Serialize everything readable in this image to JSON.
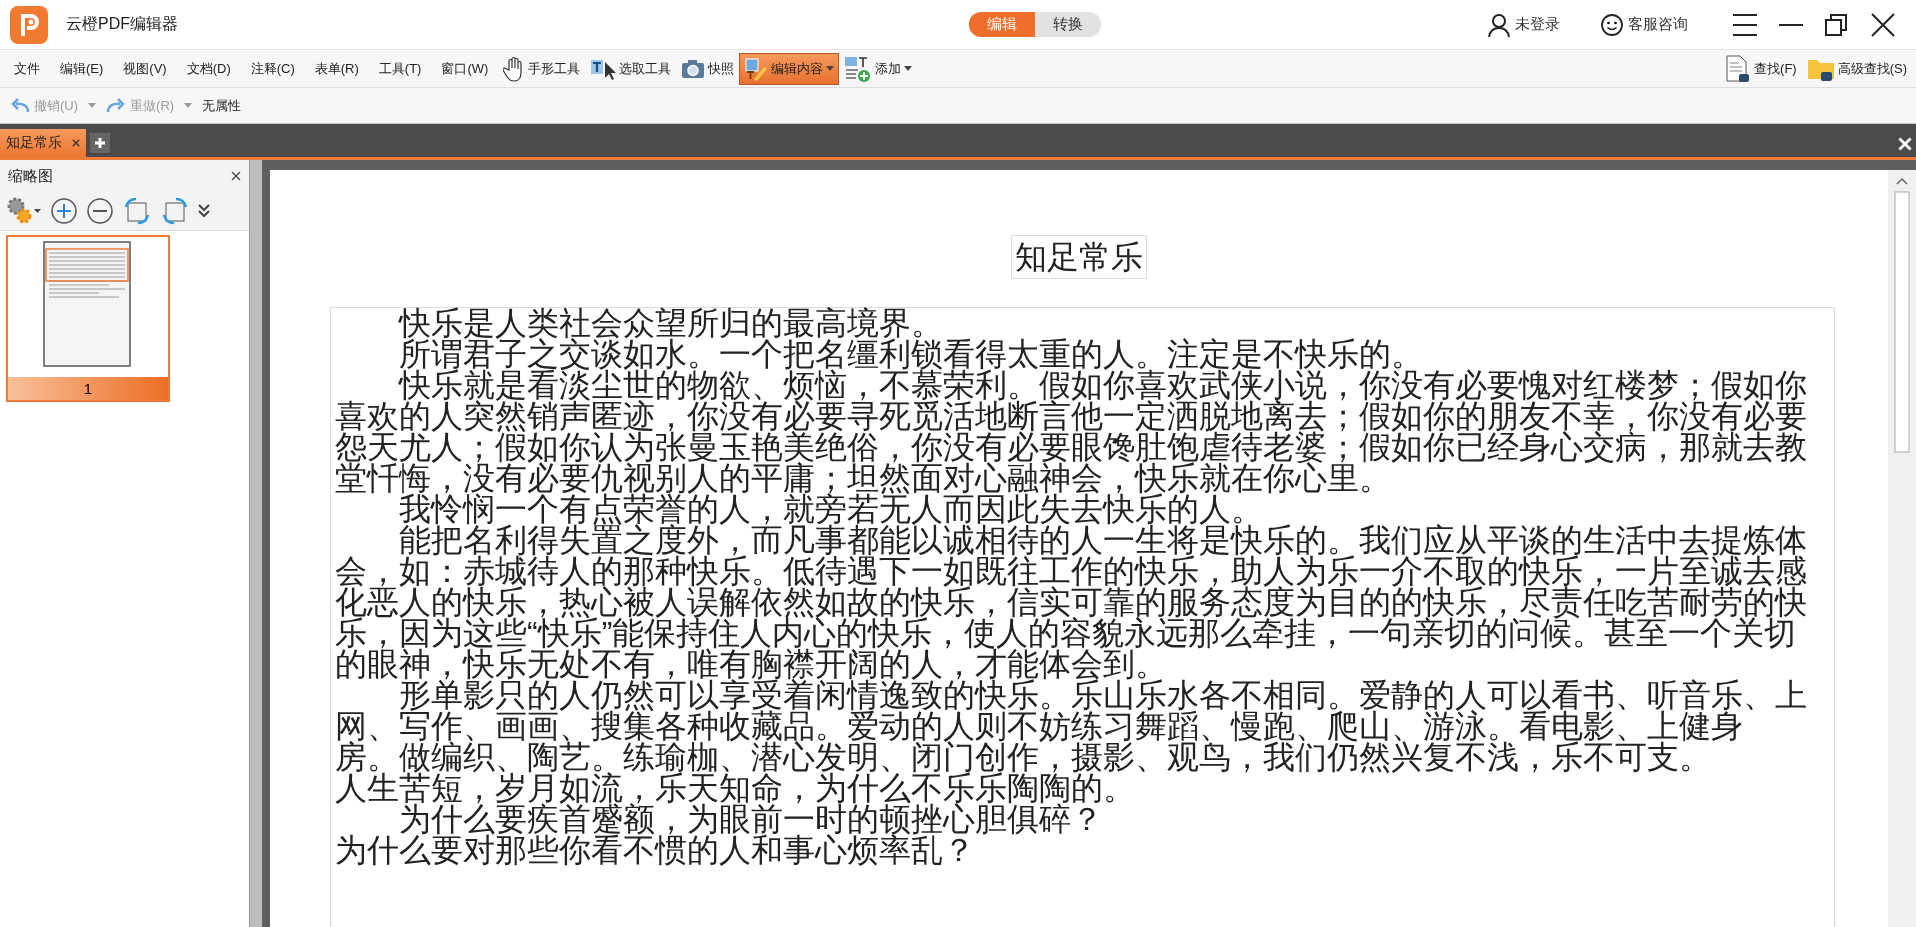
{
  "app": {
    "title": "云橙PDF编辑器"
  },
  "mode_tabs": [
    {
      "label": "编辑",
      "selected": true
    },
    {
      "label": "转换",
      "selected": false
    }
  ],
  "account": {
    "login": "未登录",
    "support": "客服咨询"
  },
  "menu": [
    "文件",
    "编辑(E)",
    "视图(V)",
    "文档(D)",
    "注释(C)",
    "表单(R)",
    "工具(T)",
    "窗口(W)"
  ],
  "tools": [
    {
      "kind": "hand",
      "label": "手形工具",
      "active": false,
      "dropdown": false
    },
    {
      "kind": "select",
      "label": "选取工具",
      "active": false,
      "dropdown": false
    },
    {
      "kind": "snapshot",
      "label": "快照",
      "active": false,
      "dropdown": false
    },
    {
      "kind": "edit",
      "label": "编辑内容",
      "active": true,
      "dropdown": true
    },
    {
      "kind": "add",
      "label": "添加",
      "active": false,
      "dropdown": true
    }
  ],
  "search_tools": [
    {
      "kind": "find",
      "label": "查找(F)"
    },
    {
      "kind": "advanced",
      "label": "高级查找(S)"
    }
  ],
  "history": [
    {
      "kind": "undo",
      "label": "撤销(U)",
      "disabled": true
    },
    {
      "kind": "redo",
      "label": "重做(R)",
      "disabled": true
    }
  ],
  "properties_label": "无属性",
  "document_tabs": [
    {
      "label": "知足常乐",
      "selected": true
    }
  ],
  "thumbnail_panel": {
    "title": "缩略图",
    "pages": [
      {
        "label": "1",
        "selected": true
      }
    ]
  },
  "document": {
    "title": "知足常乐",
    "lines": [
      {
        "text": "快乐是人类社会众望所归的最高境界。",
        "indented": true
      },
      {
        "text": "所谓君子之交谈如水。一个把名缰利锁看得太重的人。注定是不快乐的。",
        "indented": true
      },
      {
        "text": "快乐就是看淡尘世的物欲、烦恼，不慕荣利。假如你喜欢武侠小说，你没有必要愧对红楼梦；假如你",
        "indented": true
      },
      {
        "text": "喜欢的人突然销声匿迹，你没有必要寻死觅活地断言他一定洒脱地离去；假如你的朋友不幸，你没有必要",
        "indented": false
      },
      {
        "text": "怨天尤人；假如你认为张曼玉艳美绝俗，你没有必要眼馋肚饱虐待老婆；假如你已经身心交病，那就去教",
        "indented": false
      },
      {
        "text": "堂忏悔，没有必要仇视别人的平庸；坦然面对心融神会，快乐就在你心里。",
        "indented": false
      },
      {
        "text": "我怜悯一个有点荣誉的人，就旁若无人而因此失去快乐的人。",
        "indented": true
      },
      {
        "text": "能把名利得失置之度外，而凡事都能以诚相待的人一生将是快乐的。我们应从平谈的生活中去提炼体",
        "indented": true
      },
      {
        "text": "会，如：赤城待人的那种快乐。低待遇下一如既往工作的快乐，助人为乐一介不取的快乐，一片至诚去感",
        "indented": false
      },
      {
        "text": "化恶人的快乐，热心被人误解依然如故的快乐，信实可靠的服务态度为目的的快乐，尽责任吃苦耐劳的快",
        "indented": false
      },
      {
        "text": "乐，因为这些“快乐”能保持住人内心的快乐，使人的容貌永远那么牵挂，一句亲切的问候。甚至一个关切",
        "indented": false
      },
      {
        "text": "的眼神，快乐无处不有，唯有胸襟开阔的人，才能体会到。",
        "indented": false
      },
      {
        "text": "形单影只的人仍然可以享受着闲情逸致的快乐。乐山乐水各不相同。爱静的人可以看书、听音乐、上",
        "indented": true
      },
      {
        "text": "网、写作、画画、搜集各种收藏品。爱动的人则不妨练习舞蹈、慢跑、爬山、游泳。看电影、上健身",
        "indented": false
      },
      {
        "text": "房。做编织、陶艺。练瑜枷、潜心发明、闭门创作，摄影、观鸟，我们仍然兴复不浅，乐不可支。",
        "indented": false
      },
      {
        "text": "人生苦短，岁月如流，乐天知命，为什么不乐乐陶陶的。",
        "indented": false
      },
      {
        "text": "为什么要疾首蹙额，为眼前一时的顿挫心胆俱碎？",
        "indented": true
      },
      {
        "text": "为什么要对那些你看不惯的人和事心烦率乱？",
        "indented": false
      }
    ]
  }
}
